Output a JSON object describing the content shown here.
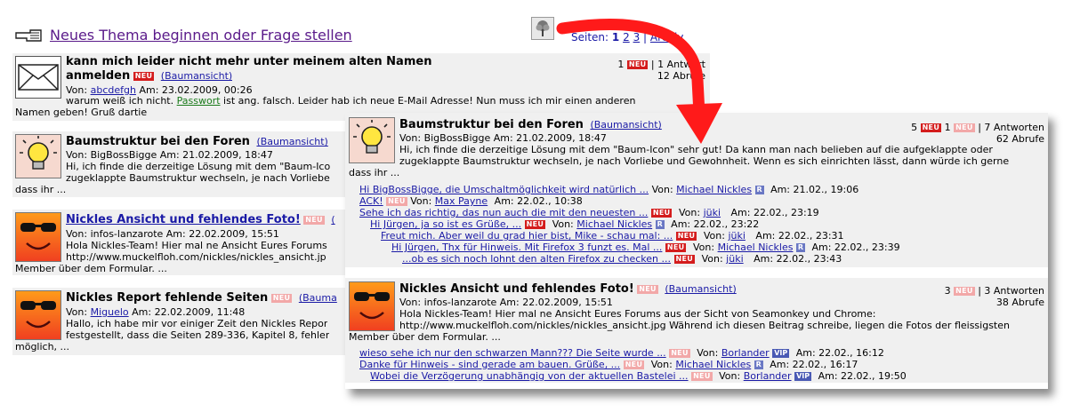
{
  "header": {
    "new_topic_label": "Neues Thema beginnen oder Frage stellen",
    "pages_label": "Seiten:",
    "pages": [
      "1",
      "2",
      "3"
    ],
    "archive_label": "Archiv"
  },
  "posts_bg": [
    {
      "title_line1": "kann mich leider nicht mehr unter meinem alten Namen",
      "title_line2": "anmelden",
      "tree_view": "(Baumansicht)",
      "von": "Von:",
      "author": "abcdefgh",
      "am": "Am: 23.02.2009, 00:26",
      "excerpt_a": "warum weiß ich nicht.",
      "excerpt_link": "Passwort",
      "excerpt_b": "ist ang. falsch. Leider hab ich neue E-Mail Adresse! Nun muss ich mir einen anderen",
      "excerpt_cut": "euen",
      "excerpt_line2": "Namen geben! Gruß dartie",
      "count_new": "1",
      "answers": "| 1 Antwort",
      "views": "12 Abrufe"
    },
    {
      "title": "Baumstruktur bei den Foren",
      "tree_view": "(Baumansicht)",
      "meta": "Von: BigBossBigge Am: 21.02.2009, 18:47",
      "excerpt_line1": "Hi, ich finde die derzeitige Lösung mit dem \"Baum-Ico",
      "excerpt_line2": "zugeklappte Baumstruktur wechseln, je nach Vorliebe",
      "excerpt_line3": "dass ihr ..."
    },
    {
      "title": "Nickles Ansicht und fehlendes Foto!",
      "tree_view_cut": "(",
      "meta": "Von: infos-lanzarote Am: 22.02.2009, 15:51",
      "excerpt_line1": "Hola Nickles-Team! Hier mal ne Ansicht Eures Forums",
      "excerpt_line2": "http://www.muckelfloh.com/nickles/nickles_ansicht.jp",
      "excerpt_line3": "Member über dem Formular. ..."
    },
    {
      "title": "Nickles Report fehlende Seiten",
      "tree_view_cut": "(Bauma",
      "von": "Von:",
      "author": "Miguelo",
      "am": "Am: 22.02.2009, 11:48",
      "excerpt_line1": "Hallo, ich habe mir vor einiger Zeit den Nickles Repor",
      "excerpt_line2": "festgestellt, dass die Seiten 289-336, Kapitel 8, fehler",
      "excerpt_line3": "möglich, ..."
    }
  ],
  "badges": {
    "neu": "NEU",
    "r": "R",
    "vip": "VIP"
  },
  "overlay": {
    "post1": {
      "title": "Baumstruktur bei den Foren",
      "tree_view": "(Baumansicht)",
      "meta": "Von: BigBossBigge Am: 21.02.2009, 18:47",
      "excerpt_line1": "Hi, ich finde die derzeitige Lösung mit dem \"Baum-Icon\" sehr gut! Da kann man nach belieben auf die aufgeklappte oder",
      "excerpt_line2": "zugeklappte Baumstruktur wechseln, je nach Vorliebe und Gewohnheit. Wenn es sich einrichten lässt, dann würde ich gerne",
      "excerpt_line3": "dass ihr ...",
      "count_a": "5",
      "count_b": "1",
      "answers": "| 7 Antworten",
      "views": "62 Abrufe",
      "replies": [
        {
          "title": "Hi BigBossBigge, die Umschaltmöglichkeit wird natürlich ...",
          "von": "Von:",
          "author": "Michael Nickles",
          "badge": "R",
          "am": "Am: 21.02., 19:06"
        },
        {
          "title": "ACK!",
          "badge_neu_light": true,
          "von": "Von:",
          "author": "Max Payne",
          "am": "Am: 22.02., 10:38"
        },
        {
          "title": "Sehe ich das richtig, das nun auch die mit den neuesten ...",
          "von": "Von:",
          "author": "jüki",
          "am": "Am: 22.02., 23:19"
        },
        {
          "title": "Hi Jürgen, ja so ist es Grüße, ...",
          "von": "Von:",
          "author": "Michael Nickles",
          "badge": "R",
          "am": "Am: 22.02., 23:22"
        },
        {
          "title": "Freut mich. Aber weil du grad hier bist, Mike - schau mal: ...",
          "von": "Von:",
          "author": "jüki",
          "am": "Am: 22.02., 23:31"
        },
        {
          "title": "Hi Jürgen, Thx für Hinweis. Mit Firefox 3 funzt es. Mal ...",
          "von": "Von:",
          "author": "Michael Nickles",
          "badge": "R",
          "am": "Am: 22.02., 23:39"
        },
        {
          "title": "...ob es sich noch lohnt den alten Firefox zu checken ...",
          "von": "Von:",
          "author": "jüki",
          "am": "Am: 22.02., 23:43"
        }
      ]
    },
    "post2": {
      "title": "Nickles Ansicht und fehlendes Foto!",
      "tree_view": "(Baumansicht)",
      "meta": "Von: infos-lanzarote Am: 22.02.2009, 15:51",
      "excerpt_line1": "Hola Nickles-Team! Hier mal ne Ansicht Eures Forums aus der Sicht von Seamonkey und Chrome:",
      "excerpt_line2": "http://www.muckelfloh.com/nickles/nickles_ansicht.jpg Während ich diesen Beitrag schreibe, liegen die Fotos der fleissigsten",
      "excerpt_line3": "Member über dem Formular. ...",
      "count_a": "3",
      "answers": "| 3 Antworten",
      "views": "38 Abrufe",
      "replies": [
        {
          "title": "wieso sehe ich nur den schwarzen Mann??? Die Seite wurde ...",
          "von": "Von:",
          "author": "Borlander",
          "badge": "VIP",
          "am": "Am: 22.02., 16:12"
        },
        {
          "title": "Danke für Hinweis - sind gerade am bauen. Grüße, ...",
          "von": "Von:",
          "author": "Michael Nickles",
          "badge": "R",
          "am": "Am: 22.02., 16:17"
        },
        {
          "title": "Wobei die Verzögerung unabhängig von der aktuellen Bastelei ...",
          "von": "Von:",
          "author": "Borlander",
          "badge": "VIP",
          "am": "Am: 22.02., 19:50"
        }
      ]
    }
  },
  "colors": {
    "link": "#1a1aa6",
    "neu": "#d41c1c",
    "neu_light": "#f2a8a8",
    "badge": "#6a78c4",
    "arrow": "#ff1a1a"
  }
}
